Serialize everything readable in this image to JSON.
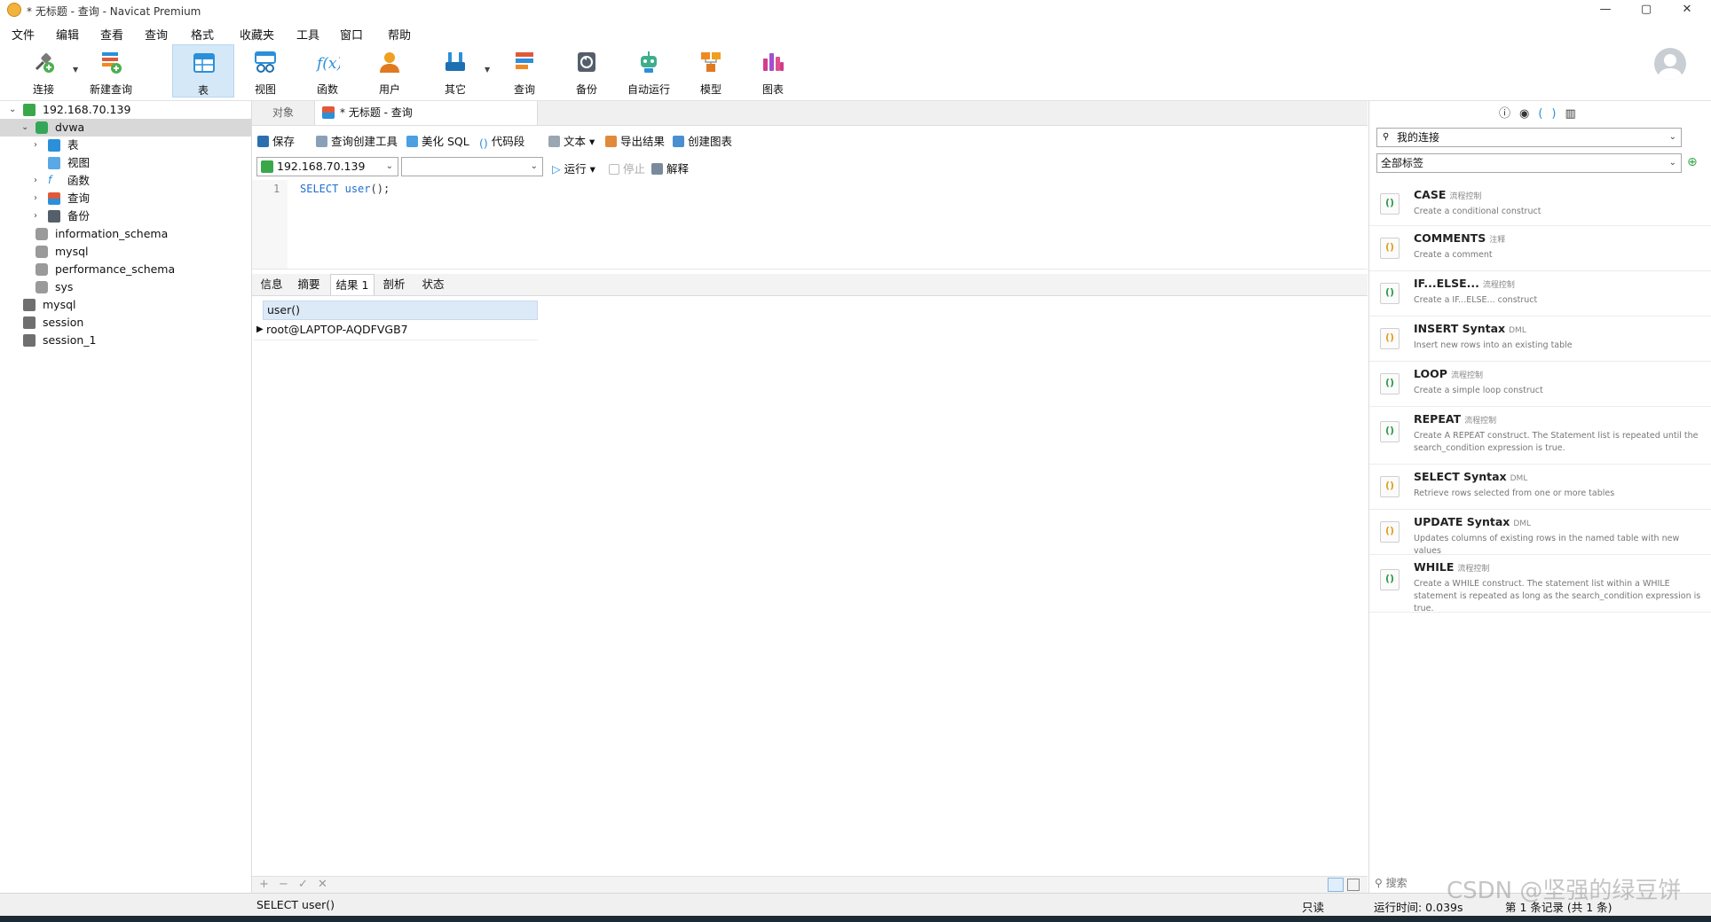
{
  "window": {
    "title": "* 无标题 - 查询 - Navicat Premium",
    "controls": [
      "—",
      "▢",
      "✕"
    ]
  },
  "menu": [
    "文件",
    "编辑",
    "查看",
    "查询",
    "格式",
    "收藏夹",
    "工具",
    "窗口",
    "帮助"
  ],
  "toolbar": [
    {
      "label": "连接",
      "icon": "connect-icon",
      "color": "#4caf50"
    },
    {
      "label": "新建查询",
      "icon": "new-query-icon",
      "color": "#e05a3a"
    },
    {
      "label": "表",
      "icon": "table-icon",
      "color": "#2b8fd9"
    },
    {
      "label": "视图",
      "icon": "view-icon",
      "color": "#2b8fd9"
    },
    {
      "label": "函数",
      "icon": "function-icon",
      "color": "#2b8fd9"
    },
    {
      "label": "用户",
      "icon": "user-icon",
      "color": "#f0a020"
    },
    {
      "label": "其它",
      "icon": "other-icon",
      "color": "#2b8fd9"
    },
    {
      "label": "查询",
      "icon": "query-icon",
      "color": "#e05a3a"
    },
    {
      "label": "备份",
      "icon": "backup-icon",
      "color": "#555f6a"
    },
    {
      "label": "自动运行",
      "icon": "robot-icon",
      "color": "#3fae8a"
    },
    {
      "label": "模型",
      "icon": "model-icon",
      "color": "#f08a20"
    },
    {
      "label": "图表",
      "icon": "chart-icon",
      "color": "#d23c8c"
    }
  ],
  "tree": {
    "root": "192.168.70.139",
    "db_selected": "dvwa",
    "db_children": [
      "表",
      "视图",
      "函数",
      "查询",
      "备份"
    ],
    "other_dbs": [
      "information_schema",
      "mysql",
      "performance_schema",
      "sys"
    ],
    "connections": [
      "mysql",
      "session",
      "session_1"
    ]
  },
  "editor": {
    "tab_objects": "对象",
    "tab_query": "* 无标题 - 查询",
    "actions": {
      "save": "保存",
      "builder": "查询创建工具",
      "beautify": "美化 SQL",
      "snippet": "代码段",
      "text": "文本",
      "export": "导出结果",
      "chart": "创建图表"
    },
    "connection": "192.168.70.139",
    "database": "",
    "run": "运行",
    "stop": "停止",
    "explain": "解释",
    "line_no": "1",
    "sql_keyword": "SELECT",
    "sql_func": "user",
    "sql_rest": "();"
  },
  "results": {
    "tabs": [
      "信息",
      "摘要",
      "结果 1",
      "剖析",
      "状态"
    ],
    "active_tab": "结果 1",
    "column": "user()",
    "row_value": "root@LAPTOP-AQDFVGB7"
  },
  "bottom_tools": [
    "+",
    "−",
    "✓",
    "✕"
  ],
  "status": {
    "sql": "SELECT user()",
    "readonly": "只读",
    "time": "运行时间: 0.039s",
    "records": "第 1 条记录 (共 1 条)"
  },
  "right_panel": {
    "connection_select": "我的连接",
    "tag_select": "全部标签",
    "search_placeholder": "搜索",
    "snippets": [
      {
        "name": "CASE",
        "tag": "流程控制",
        "desc": "Create a conditional construct"
      },
      {
        "name": "COMMENTS",
        "tag": "注释",
        "desc": "Create a comment"
      },
      {
        "name": "IF...ELSE...",
        "tag": "流程控制",
        "desc": "Create a IF...ELSE... construct"
      },
      {
        "name": "INSERT Syntax",
        "tag": "DML",
        "desc": "Insert new rows into an existing table"
      },
      {
        "name": "LOOP",
        "tag": "流程控制",
        "desc": "Create a simple loop construct"
      },
      {
        "name": "REPEAT",
        "tag": "流程控制",
        "desc": "Create A REPEAT construct. The Statement list is repeated until the search_condition expression is true."
      },
      {
        "name": "SELECT Syntax",
        "tag": "DML",
        "desc": "Retrieve rows selected from one or more tables"
      },
      {
        "name": "UPDATE Syntax",
        "tag": "DML",
        "desc": "Updates columns of existing rows in the named table with new values"
      },
      {
        "name": "WHILE",
        "tag": "流程控制",
        "desc": "Create a WHILE construct. The statement list within a WHILE statement is repeated as long as the search_condition expression is true."
      }
    ]
  },
  "watermark": "CSDN @坚强的绿豆饼"
}
